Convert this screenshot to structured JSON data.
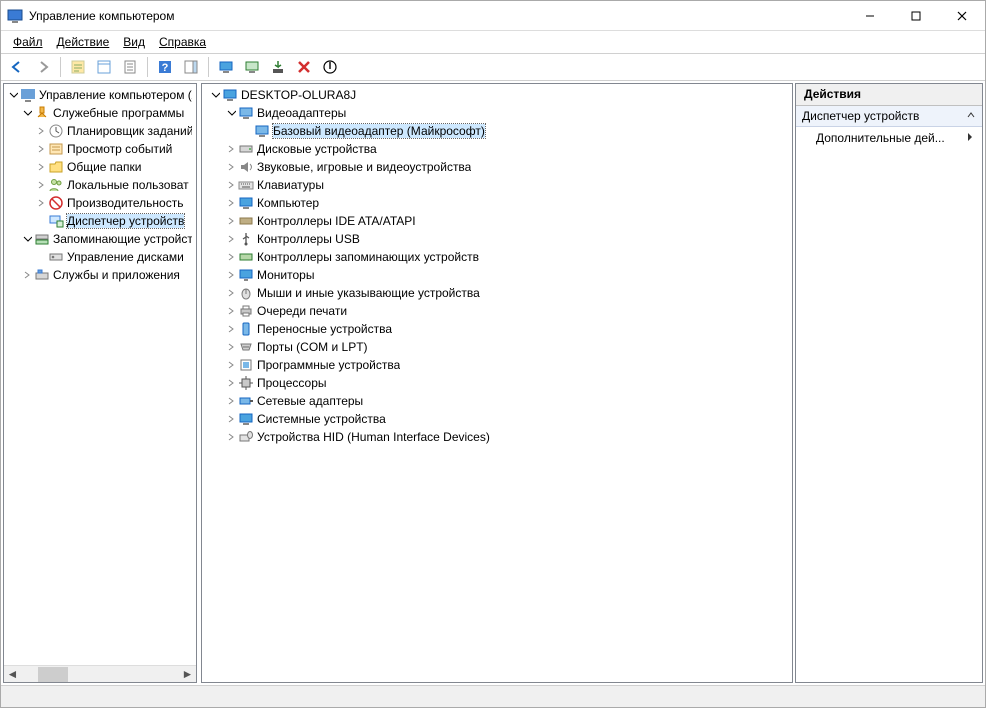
{
  "window": {
    "title": "Управление компьютером"
  },
  "menu": {
    "file": "Файл",
    "action": "Действие",
    "view": "Вид",
    "help": "Справка"
  },
  "left_tree": {
    "root": "Управление компьютером (л",
    "system_tools": "Служебные программы",
    "task_scheduler": "Планировщик заданий",
    "event_viewer": "Просмотр событий",
    "shared_folders": "Общие папки",
    "local_users": "Локальные пользоват",
    "performance": "Производительность",
    "device_manager": "Диспетчер устройств",
    "storage": "Запоминающие устройст",
    "disk_mgmt": "Управление дисками",
    "services_apps": "Службы и приложения"
  },
  "mid_tree": {
    "root": "DESKTOP-OLURA8J",
    "video_adapters": "Видеоадаптеры",
    "basic_video": "Базовый видеоадаптер (Майкрософт)",
    "disk_devices": "Дисковые устройства",
    "sound_devices": "Звуковые, игровые и видеоустройства",
    "keyboards": "Клавиатуры",
    "computer": "Компьютер",
    "ide_ata": "Контроллеры IDE ATA/ATAPI",
    "usb": "Контроллеры USB",
    "storage_ctrl": "Контроллеры запоминающих устройств",
    "monitors": "Мониторы",
    "mice": "Мыши и иные указывающие устройства",
    "print_queues": "Очереди печати",
    "portable": "Переносные устройства",
    "ports": "Порты (COM и LPT)",
    "software_devices": "Программные устройства",
    "processors": "Процессоры",
    "network": "Сетевые адаптеры",
    "system_devices": "Системные устройства",
    "hid": "Устройства HID (Human Interface Devices)"
  },
  "actions": {
    "header": "Действия",
    "section": "Диспетчер устройств",
    "more": "Дополнительные дей..."
  }
}
